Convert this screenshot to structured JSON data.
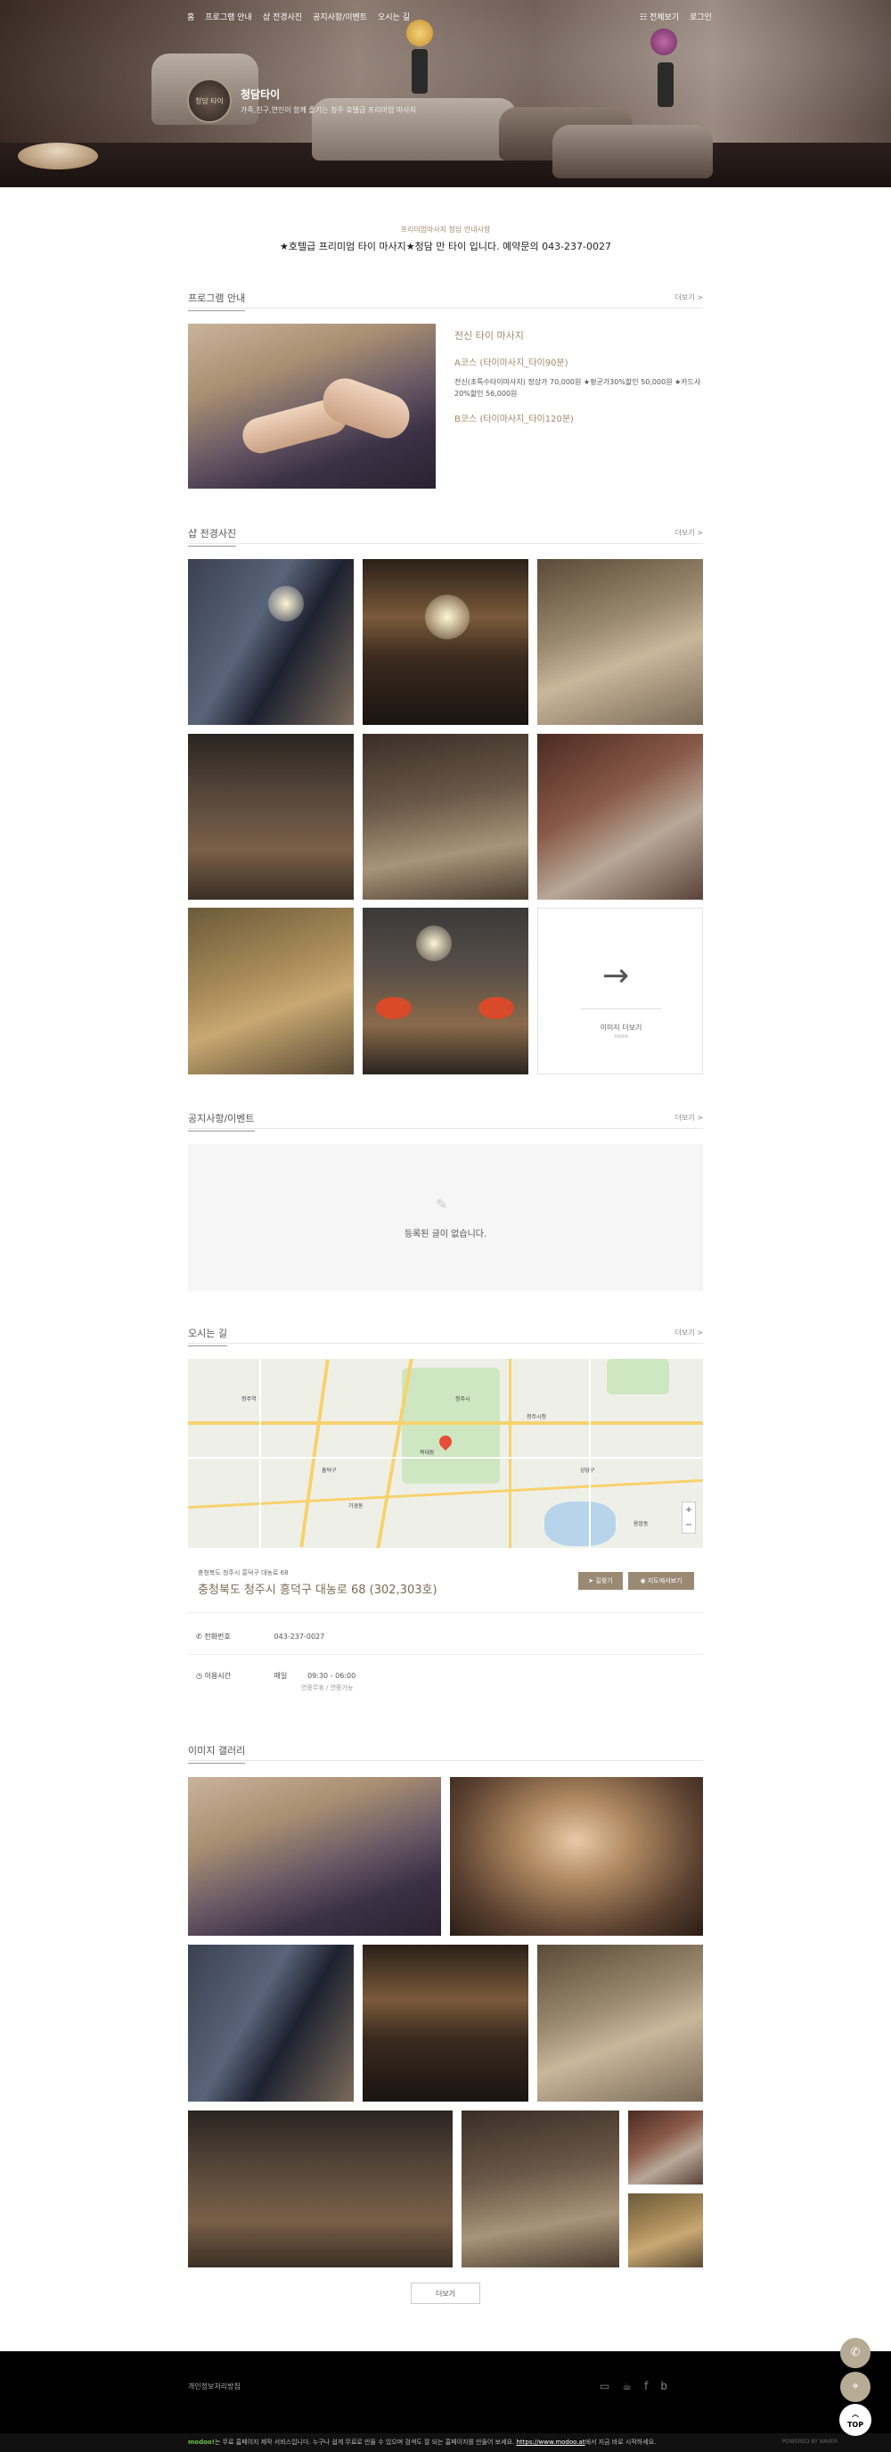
{
  "nav": {
    "items": [
      "홈",
      "프로그램 안내",
      "샵 전경사진",
      "공지사항/이벤트",
      "오시는 길"
    ],
    "all_view": "전체보기",
    "login": "로그인"
  },
  "brand": {
    "logo_text": "청담 타이",
    "name": "청담타이",
    "desc": "가족,친구,연인이 함께 즐기는 청주 호텔급 프리미엄 마사지"
  },
  "intro": {
    "sub": "프리미엄마사지 청담 안내사항",
    "main": "★호텔급 프리미엄 타이 마사지★청담 만 타이 입니다. 예약문의 043-237-0027"
  },
  "program": {
    "title": "프로그램 안내",
    "more": "더보기 >",
    "t1": "전신 타이 마사지",
    "t2": "A코스 (타이마사지_타이90분)",
    "t3": "전신(초특수타이마사지) 정상가 70,000원 ★평균가30%할인 50,000원 ★카드사20%할인 56,000원",
    "t4": "B코스 (타이마사지_타이120분)"
  },
  "shop": {
    "title": "샵 전경사진",
    "more": "더보기 >",
    "more_tile_label": "이미지 더보기",
    "more_tile_sub": "more"
  },
  "notice": {
    "title": "공지사항/이벤트",
    "more": "더보기 >",
    "empty_msg": "등록된 글이 없습니다."
  },
  "location": {
    "title": "오시는 길",
    "more": "더보기 >",
    "addr_small": "충청북도 청주시 흥덕구 대농로 68",
    "addr_main": "충청북도 청주시 흥덕구 대농로 68 (302,303호)",
    "copy_btn": "길찾기",
    "map_btn": "지도에서보기",
    "phone_label": "전화번호",
    "phone": "043-237-0027",
    "hours_label": "이용시간",
    "hours_day": "매일",
    "hours_time": "09:30 - 06:00",
    "hours_note": "연중무휴 / 연중가능",
    "map_labels": [
      "청주시",
      "청주시청",
      "상당구",
      "흥덕구",
      "청주역",
      "복대동",
      "가경동",
      "용암동"
    ]
  },
  "gallery": {
    "title": "이미지 갤러리",
    "more_btn": "더보기"
  },
  "footer": {
    "privacy": "개인정보처리방침",
    "brand": "modoo!",
    "text": "는 무료 홈페이지 제작 서비스입니다. 누구나 쉽게 무료로 만들 수 있으며 검색도 잘 되는 홈페이지를 만들어 보세요.",
    "link": "https://www.modoo.at",
    "link_suffix": "에서 지금 바로 시작하세요.",
    "powered": "POWERED BY NAVER"
  },
  "float": {
    "phone_icon": "phone-icon",
    "location_icon": "location-icon",
    "top": "TOP"
  }
}
